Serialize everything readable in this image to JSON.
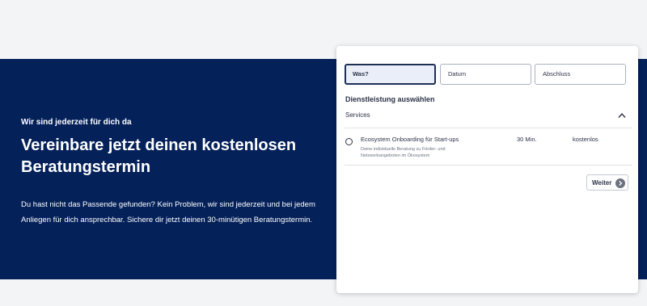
{
  "hero": {
    "eyebrow": "Wir sind jederzeit für dich da",
    "title": "Vereinbare jetzt deinen kostenlosen Beratungstermin",
    "text": "Du hast nicht das Passende gefunden? Kein Problem, wir sind jederzeit und bei jedem Anliegen für dich ansprechbar. Sichere dir jetzt deinen 30-minütigen Beratungstermin."
  },
  "booking": {
    "tabs": [
      {
        "label": "Was?",
        "active": true
      },
      {
        "label": "Datum",
        "active": false
      },
      {
        "label": "Abschluss",
        "active": false
      }
    ],
    "section_heading": "Dienstleistung auswählen",
    "services_label": "Services",
    "services_expanded": true,
    "services": [
      {
        "name": "Ecosystem Onboarding für Start-ups",
        "description": "Deine individuelle Beratung zu Förder- und Netzwerkangeboten im Ökosystem",
        "duration": "30 Min.",
        "price": "kostenlos",
        "selected": false
      }
    ],
    "next_label": "Weiter"
  },
  "colors": {
    "hero_bg": "#04215a",
    "page_bg": "#f3f4f6",
    "text_dark": "#2c3347",
    "next_icon_bg": "#6b7280"
  },
  "icons": {
    "services_toggle": "chevron-up-icon",
    "next": "arrow-right-circle-icon"
  }
}
